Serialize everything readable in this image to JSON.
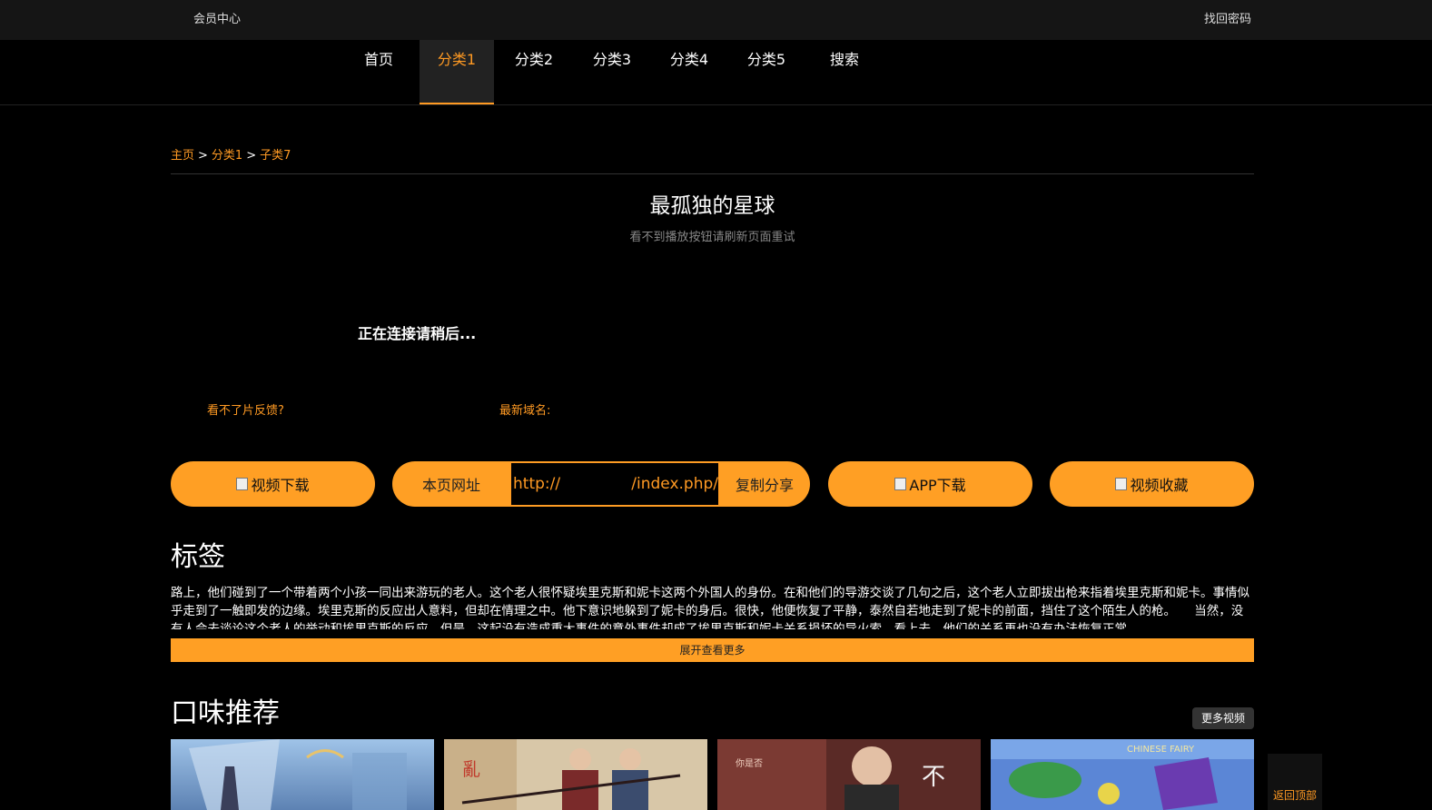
{
  "topbar": {
    "member_center": "会员中心",
    "recover_password": "找回密码"
  },
  "nav": {
    "items": [
      {
        "label": "首页",
        "active": false
      },
      {
        "label": "分类1",
        "active": true
      },
      {
        "label": "分类2",
        "active": false
      },
      {
        "label": "分类3",
        "active": false
      },
      {
        "label": "分类4",
        "active": false
      },
      {
        "label": "分类5",
        "active": false
      },
      {
        "label": "搜索",
        "active": false
      }
    ]
  },
  "breadcrumb": {
    "home": "主页",
    "sep": ">",
    "category": "分类1",
    "sub": "子类7"
  },
  "video": {
    "title": "最孤独的星球",
    "tip": "看不到播放按钮请刷新页面重试",
    "connecting": "正在连接请稍后...",
    "feedback": "看不了片反馈?",
    "new_domain": "最新域名:"
  },
  "actions": {
    "download": "视频下载",
    "url_label": "本页网址",
    "url_value_start": "http://",
    "url_value_end": "/index.php/",
    "copy_share": "复制分享",
    "app_download": "APP下载",
    "favorite": "视频收藏"
  },
  "tags": {
    "heading": "标签",
    "description": "路上，他们碰到了一个带着两个小孩一同出来游玩的老人。这个老人很怀疑埃里克斯和妮卡这两个外国人的身份。在和他们的导游交谈了几句之后，这个老人立即拔出枪来指着埃里克斯和妮卡。事情似乎走到了一触即发的边缘。埃里克斯的反应出人意料，但却在情理之中。他下意识地躲到了妮卡的身后。很快，他便恢复了平静，泰然自若地走到了妮卡的前面，挡住了这个陌生人的枪。　　当然，没有人会去谈论这个老人的举动和埃里克斯的反应。但是，这起没有造成重大事件的意外事件却成了埃里克斯和妮卡关系损坏的导火索。看上去，他们的关系再也没有办法恢复正常。",
    "expand": "展开查看更多"
  },
  "recommend": {
    "heading": "口味推荐",
    "more": "更多视频"
  },
  "back_to_top": "返回顶部",
  "colors": {
    "accent": "#ff9f24",
    "background": "#000000",
    "topbar": "#151515"
  }
}
